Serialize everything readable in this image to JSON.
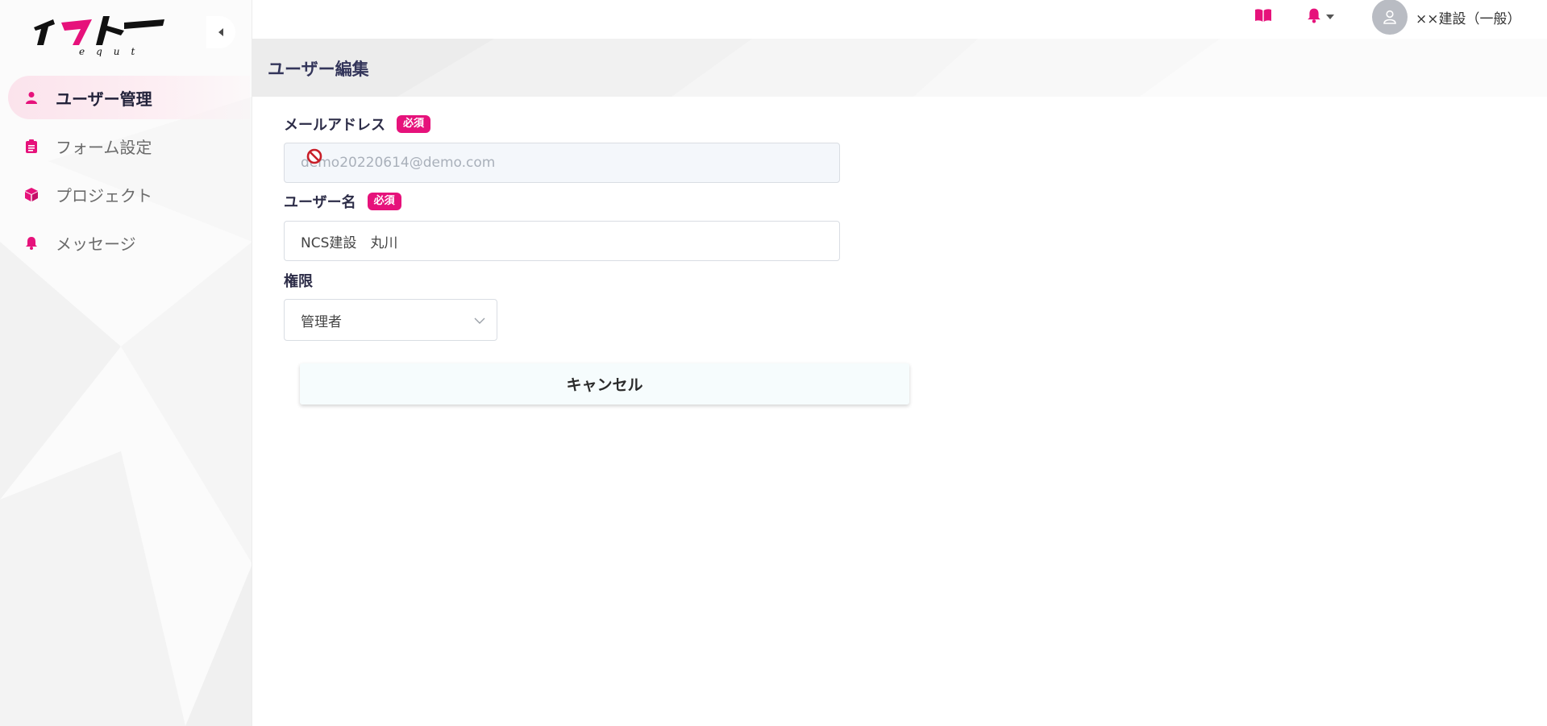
{
  "app": {
    "logo_text": "イクト",
    "logo_subtext": "equt",
    "brand_color": "#e6127b"
  },
  "sidebar": {
    "items": [
      {
        "label": "ユーザー管理",
        "icon": "user-icon",
        "active": true
      },
      {
        "label": "フォーム設定",
        "icon": "clipboard-icon",
        "active": false
      },
      {
        "label": "プロジェクト",
        "icon": "cube-icon",
        "active": false
      },
      {
        "label": "メッセージ",
        "icon": "bell-icon",
        "active": false
      }
    ]
  },
  "topbar": {
    "icons": [
      "book-icon",
      "bell-icon",
      "user-icon"
    ],
    "user_name": "××建設（一般）"
  },
  "page": {
    "title": "ユーザー編集"
  },
  "form": {
    "email": {
      "label": "メールアドレス",
      "required_badge": "必須",
      "value": "demo20220614@demo.com",
      "disabled": true
    },
    "username": {
      "label": "ユーザー名",
      "required_badge": "必須",
      "value": "NCS建設　丸川"
    },
    "role": {
      "label": "権限",
      "selected": "管理者"
    },
    "cancel_label": "キャンセル"
  }
}
